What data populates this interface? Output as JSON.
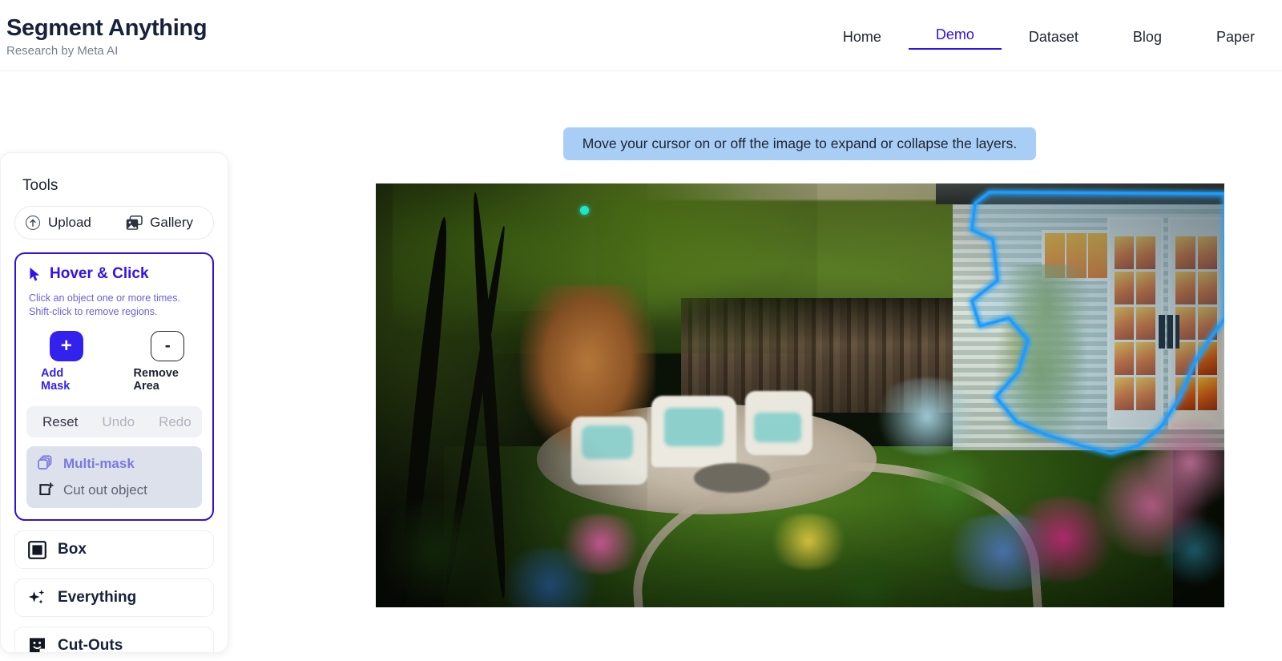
{
  "header": {
    "title": "Segment Anything",
    "subtitle": "Research by Meta AI",
    "nav": [
      {
        "label": "Home",
        "active": false
      },
      {
        "label": "Demo",
        "active": true
      },
      {
        "label": "Dataset",
        "active": false
      },
      {
        "label": "Blog",
        "active": false
      },
      {
        "label": "Paper",
        "active": false
      }
    ]
  },
  "tools_panel": {
    "heading": "Tools",
    "upload": {
      "label": "Upload",
      "icon": "upload-arrow-icon"
    },
    "gallery": {
      "label": "Gallery",
      "icon": "gallery-images-icon"
    },
    "hover_click": {
      "title": "Hover & Click",
      "icon": "cursor-arrow-icon",
      "help_line1": "Click an object one or more times.",
      "help_line2": "Shift-click to remove regions.",
      "add_mask": {
        "label": "Add Mask",
        "glyph": "+"
      },
      "remove_area": {
        "label": "Remove Area",
        "glyph": "-"
      },
      "history": {
        "reset": "Reset",
        "undo": "Undo",
        "redo": "Redo",
        "reset_enabled": true,
        "undo_enabled": false,
        "redo_enabled": false
      },
      "multi_mask": {
        "label": "Multi-mask",
        "icon": "layers-stack-icon"
      },
      "cut_out": {
        "label": "Cut out object",
        "icon": "cut-out-icon"
      }
    },
    "other_tools": [
      {
        "label": "Box",
        "icon": "box-select-icon"
      },
      {
        "label": "Everything",
        "icon": "sparkles-icon"
      },
      {
        "label": "Cut-Outs",
        "icon": "sticker-face-icon"
      }
    ]
  },
  "tooltip": {
    "text": "Move your cursor on or off the image to expand or collapse the layers."
  },
  "canvas": {
    "alt": "Garden patio scene with shed, flowers and lawn",
    "segment_highlight": "glowing blue mask outline around garden shed wall",
    "click_marker": "cyan positive click point"
  },
  "colors": {
    "accent": "#3311ee",
    "accent_border": "#3311dd",
    "add_mask": "#3322ee",
    "tooltip_bg": "#a9cef6",
    "multi_mask_bg": "#dde1ec",
    "multi_mask_text": "#7b79e0",
    "history_bg": "#f1f2f6",
    "mask_glow": "#2196f3",
    "click_dot": "#18e8d0",
    "title": "#16213b",
    "subtitle": "#75808f"
  }
}
